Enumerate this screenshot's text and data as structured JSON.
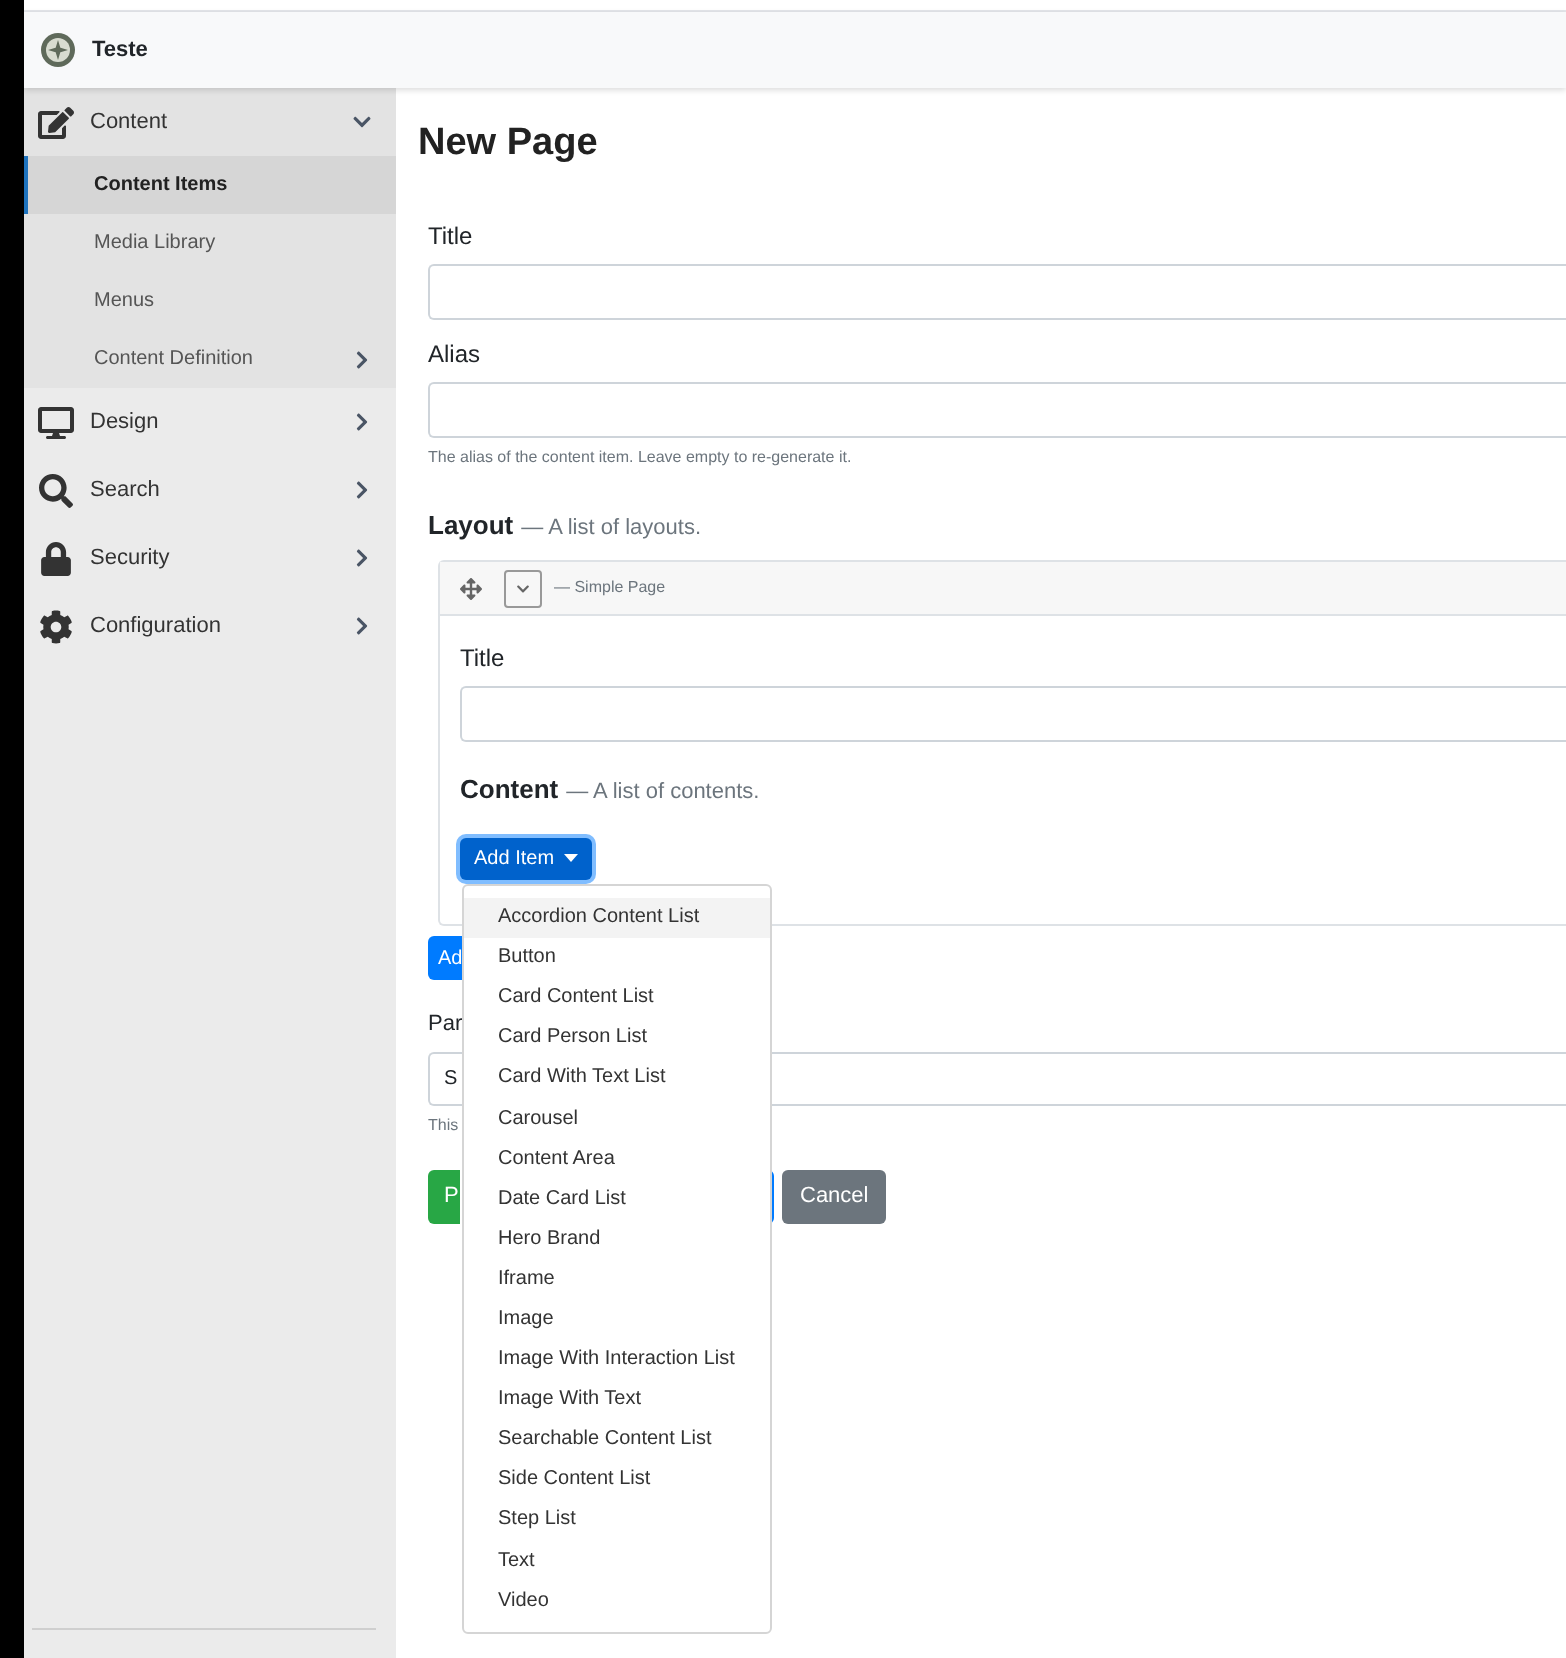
{
  "header": {
    "site_name": "Teste"
  },
  "sidebar": {
    "items": [
      {
        "label": "Content",
        "expanded": true,
        "children": [
          {
            "label": "Content Items",
            "selected": true,
            "has_submenu": false
          },
          {
            "label": "Media Library",
            "selected": false,
            "has_submenu": false
          },
          {
            "label": "Menus",
            "selected": false,
            "has_submenu": false
          },
          {
            "label": "Content Definition",
            "selected": false,
            "has_submenu": true
          }
        ]
      },
      {
        "label": "Design",
        "expanded": false
      },
      {
        "label": "Search",
        "expanded": false
      },
      {
        "label": "Security",
        "expanded": false
      },
      {
        "label": "Configuration",
        "expanded": false
      }
    ]
  },
  "page": {
    "title": "New Page",
    "fields": [
      {
        "label": "Title"
      },
      {
        "label": "Alias",
        "hint": "The alias of the content item. Leave empty to re-generate it."
      }
    ],
    "layout": {
      "label": "Layout",
      "description": "— A list of layouts.",
      "item_type": "— Simple Page",
      "title_label": "Title",
      "content_label": "Content",
      "content_description": "— A list of contents.",
      "add_button": "Add Item",
      "menu": [
        {
          "label": "Accordion Content List",
          "highlighted": true
        },
        {
          "label": "Button",
          "highlighted": false
        },
        {
          "label": "Card Content List",
          "highlighted": false
        },
        {
          "label": "Card Person List",
          "highlighted": false
        },
        {
          "label": "Card With Text List",
          "highlighted": false
        },
        {
          "label": "Carousel",
          "highlighted": false
        },
        {
          "label": "Content Area",
          "highlighted": false
        },
        {
          "label": "Date Card List",
          "highlighted": false
        },
        {
          "label": "Hero Brand",
          "highlighted": false
        },
        {
          "label": "Iframe",
          "highlighted": false
        },
        {
          "label": "Image",
          "highlighted": false
        },
        {
          "label": "Image With Interaction List",
          "highlighted": false
        },
        {
          "label": "Image With Text",
          "highlighted": false
        },
        {
          "label": "Searchable Content List",
          "highlighted": false
        },
        {
          "label": "Side Content List",
          "highlighted": false
        },
        {
          "label": "Step List",
          "highlighted": false
        },
        {
          "label": "Text",
          "highlighted": false
        },
        {
          "label": "Video",
          "highlighted": false
        }
      ]
    },
    "partial": {
      "add_button": "Ad",
      "field_label": "Par",
      "select_value": "S",
      "hint": "This",
      "publish_button": "P",
      "cancel_button": "Cancel"
    }
  }
}
